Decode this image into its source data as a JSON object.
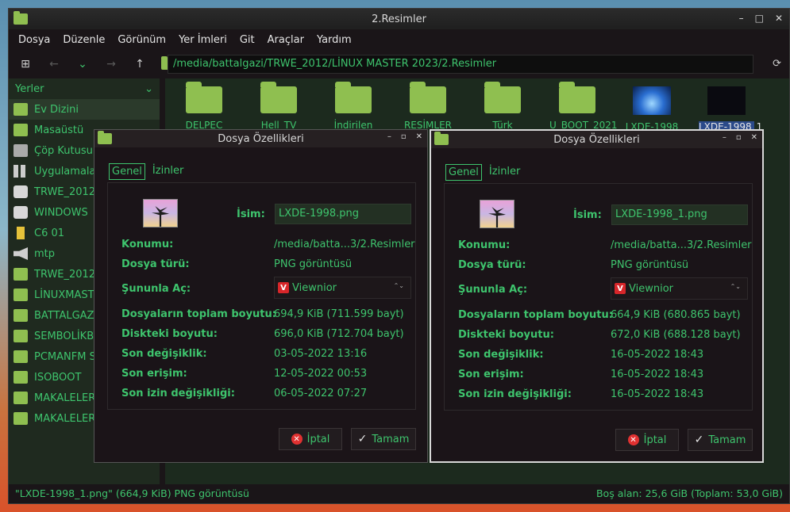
{
  "window": {
    "title": "2.Resimler",
    "controls": [
      "–",
      "□",
      "✕"
    ]
  },
  "menu": [
    "Dosya",
    "Düzenle",
    "Görünüm",
    "Yer İmleri",
    "Git",
    "Araçlar",
    "Yardım"
  ],
  "toolbar": {
    "path": "/media/battalgazi/TRWE_2012/LİNUX MASTER 2023/2.Resimler"
  },
  "sidebar": {
    "header": "Yerler",
    "items": [
      {
        "label": "Ev Dizini",
        "icon": "folder"
      },
      {
        "label": "Masaüstü",
        "icon": "folder"
      },
      {
        "label": "Çöp Kutusu",
        "icon": "trash"
      },
      {
        "label": "Uygulamalar",
        "icon": "grid"
      },
      {
        "label": "TRWE_2012",
        "icon": "drive"
      },
      {
        "label": "WINDOWS",
        "icon": "drive"
      },
      {
        "label": "C6 01",
        "icon": "phone"
      },
      {
        "label": "mtp",
        "icon": "speaker"
      },
      {
        "label": "TRWE_2012",
        "icon": "folder"
      },
      {
        "label": "LİNUXMAST",
        "icon": "folder"
      },
      {
        "label": "BATTALGAZ",
        "icon": "folder"
      },
      {
        "label": "SEMBOLİKB",
        "icon": "folder"
      },
      {
        "label": "PCMANFM S",
        "icon": "folder"
      },
      {
        "label": "ISOBOOT",
        "icon": "folder"
      },
      {
        "label": "MAKALELER",
        "icon": "folder"
      },
      {
        "label": "MAKALELER",
        "icon": "folder"
      }
    ]
  },
  "files": [
    {
      "label": "DELPEC",
      "icon": "folder"
    },
    {
      "label": "Hell_TV",
      "icon": "folder"
    },
    {
      "label": "İndirilen",
      "icon": "folder"
    },
    {
      "label": "RESİMLER",
      "icon": "folder"
    },
    {
      "label": "Türk",
      "icon": "folder"
    },
    {
      "label": "U_BOOT_2021",
      "icon": "folder"
    },
    {
      "label": "LXDE-1998",
      "icon": "image-lxde"
    },
    {
      "label": "LXDE-1998_1",
      "icon": "image-dark"
    }
  ],
  "statusbar": {
    "left": "\"LXDE-1998_1.png\" (664,9 KiB) PNG görüntüsü",
    "right": "Boş alan: 25,6 GiB (Toplam: 53,0 GiB)"
  },
  "dialogs": [
    {
      "title": "Dosya Özellikleri",
      "tabs": [
        "Genel",
        "İzinler"
      ],
      "name_label": "İsim:",
      "name_value": "LXDE-1998.png",
      "rows": [
        {
          "label": "Konumu:",
          "value": "/media/batta...3/2.Resimler"
        },
        {
          "label": "Dosya türü:",
          "value": "PNG görüntüsü"
        },
        {
          "label": "Şununla Aç:",
          "value": "Viewnior"
        },
        {
          "label": "Dosyaların toplam boyutu:",
          "value": "694,9 KiB (711.599 bayt)"
        },
        {
          "label": "Diskteki boyutu:",
          "value": "696,0 KiB (712.704 bayt)"
        },
        {
          "label": "Son değişiklik:",
          "value": "03-05-2022 13:16"
        },
        {
          "label": "Son erişim:",
          "value": "12-05-2022 00:53"
        },
        {
          "label": "Son izin değişikliği:",
          "value": "06-05-2022 07:27"
        }
      ],
      "cancel": "İptal",
      "ok": "Tamam"
    },
    {
      "title": "Dosya Özellikleri",
      "tabs": [
        "Genel",
        "İzinler"
      ],
      "name_label": "İsim:",
      "name_value": "LXDE-1998_1.png",
      "rows": [
        {
          "label": "Konumu:",
          "value": "/media/batta...3/2.Resimler"
        },
        {
          "label": "Dosya türü:",
          "value": "PNG görüntüsü"
        },
        {
          "label": "Şununla Aç:",
          "value": "Viewnior"
        },
        {
          "label": "Dosyaların toplam boyutu:",
          "value": "664,9 KiB (680.865 bayt)"
        },
        {
          "label": "Diskteki boyutu:",
          "value": "672,0 KiB (688.128 bayt)"
        },
        {
          "label": "Son değişiklik:",
          "value": "16-05-2022 18:43"
        },
        {
          "label": "Son erişim:",
          "value": "16-05-2022 18:43"
        },
        {
          "label": "Son izin değişikliği:",
          "value": "16-05-2022 18:43"
        }
      ],
      "cancel": "İptal",
      "ok": "Tamam"
    }
  ]
}
